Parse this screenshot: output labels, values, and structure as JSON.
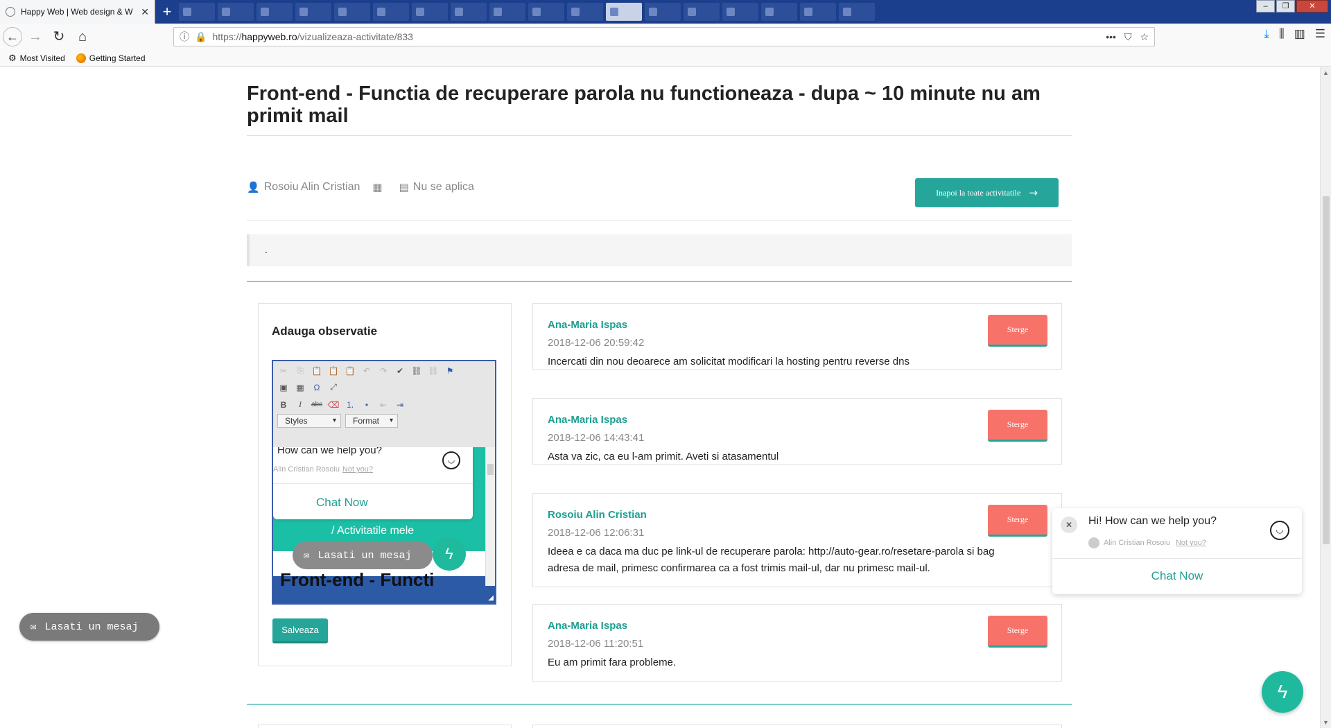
{
  "browser": {
    "active_tab_title": "Happy Web | Web design & W",
    "new_tab_label": "+",
    "url_prefix": "https://",
    "url_domain": "happyweb.ro",
    "url_path": "/vizualizeaza-activitate/833",
    "page_actions": "•••",
    "bookmarks": [
      "Most Visited",
      "Getting Started"
    ]
  },
  "page": {
    "title": "Front-end - Functia de recuperare parola nu functioneaza - dupa ~ 10 minute nu am primit mail",
    "author": "Rosoiu Alin Cristian",
    "category": "Nu se aplica",
    "back_button": "Inapoi la toate activitatile",
    "description": "."
  },
  "observation_form": {
    "heading": "Adauga observatie",
    "styles_combo": "Styles",
    "format_combo": "Format",
    "editor_preview": {
      "question": "How can we help you?",
      "who": "Alin Cristian Rosoiu",
      "not_you": "Not you?",
      "chat_now": "Chat Now",
      "nav_text": "/  Activitatile mele",
      "leave_message": "Lasati un mesaj",
      "heading_fragment": "Front-end - Functi"
    },
    "save_button": "Salveaza"
  },
  "comments": [
    {
      "author": "Ana-Maria Ispas",
      "date": "2018-12-06 20:59:42",
      "text": "Incercati din nou deoarece am solicitat modificari la hosting pentru reverse dns",
      "delete_label": "Sterge"
    },
    {
      "author": "Ana-Maria Ispas",
      "date": "2018-12-06 14:43:41",
      "text": "Asta va zic, ca eu l-am primit. Aveti si atasamentul",
      "delete_label": "Sterge"
    },
    {
      "author": "Rosoiu Alin Cristian",
      "date": "2018-12-06 12:06:31",
      "text": "Ideea e ca daca ma duc pe link-ul de recuperare parola: http://auto-gear.ro/resetare-parola si bag adresa de mail, primesc confirmarea ca a fost trimis mail-ul, dar nu primesc mail-ul.",
      "delete_label": "Sterge"
    },
    {
      "author": "Ana-Maria Ispas",
      "date": "2018-12-06 11:20:51",
      "text": "Eu am primit fara probleme.",
      "delete_label": "Sterge"
    }
  ],
  "widgets": {
    "leave_message": "Lasati un mesaj",
    "chat_question": "Hi! How can we help you?",
    "chat_who": "Alin Cristian Rosoiu",
    "chat_not_you": "Not you?",
    "chat_now": "Chat Now"
  },
  "colors": {
    "accent": "#26a69a",
    "delete": "#f7736a",
    "author": "#1f9e8f"
  }
}
